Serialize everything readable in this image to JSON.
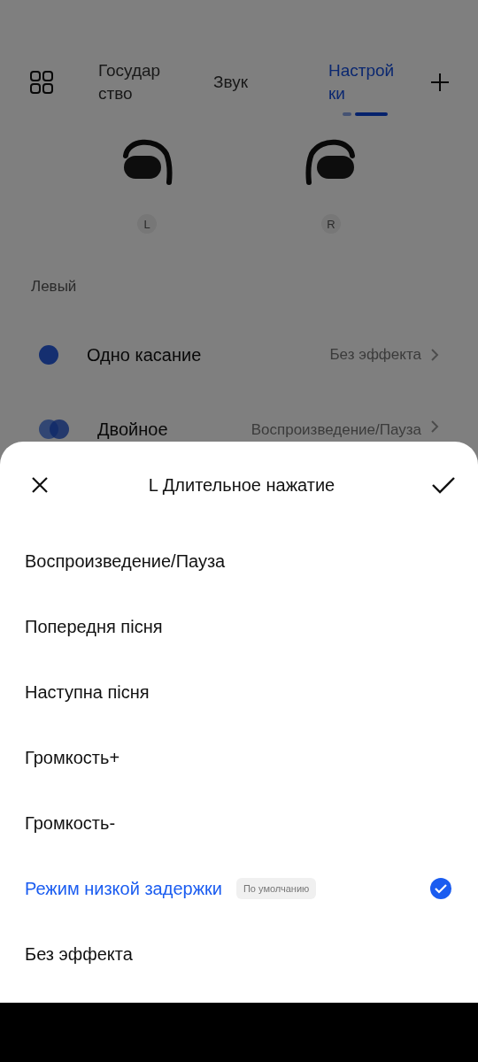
{
  "tabs": [
    {
      "label": "Государ ство",
      "selected": false
    },
    {
      "label": "Звук",
      "selected": false
    },
    {
      "label": "Настрой ки",
      "selected": true
    }
  ],
  "earbuds": [
    {
      "side": "L"
    },
    {
      "side": "R"
    }
  ],
  "section": "Левый",
  "gestures": [
    {
      "kind": "single",
      "label": "Одно касание",
      "value": "Без эффекта"
    },
    {
      "kind": "double",
      "label": "Двойное",
      "value": "Воспроизведение/Пауза"
    }
  ],
  "sheet": {
    "title": "L Длительное нажатие",
    "options": [
      {
        "label": "Воспроизведение/Пауза",
        "selected": false
      },
      {
        "label": "Попередня пісня",
        "selected": false
      },
      {
        "label": "Наступна пісня",
        "selected": false
      },
      {
        "label": "Громкость+",
        "selected": false
      },
      {
        "label": "Громкость-",
        "selected": false
      },
      {
        "label": "Режим низкой задержки",
        "badge": "По умолчанию",
        "selected": true
      },
      {
        "label": "Без эффекта",
        "selected": false
      }
    ]
  }
}
